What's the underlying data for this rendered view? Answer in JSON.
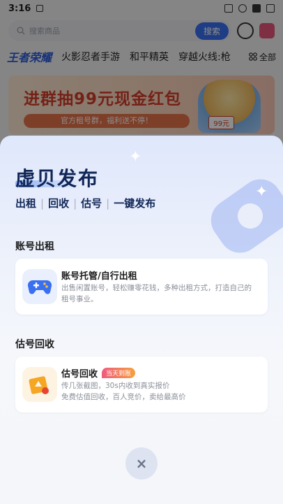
{
  "status_bar": {
    "time": "3:16"
  },
  "search": {
    "placeholder": "搜索商品",
    "button": "搜索"
  },
  "games": {
    "active": "王者荣耀",
    "items": [
      "火影忍者手游",
      "和平精英",
      "穿越火线:枪"
    ],
    "all": "全部"
  },
  "banner": {
    "headline": "进群抽99元现金红包",
    "subline": "官方租号群，福利送不停！",
    "tag": "99元"
  },
  "sheet": {
    "title": "虚贝发布",
    "features": [
      "出租",
      "回收",
      "估号",
      "一键发布"
    ],
    "rent_section": {
      "title": "账号出租",
      "card_title": "账号托管/自行出租",
      "card_desc": "出售闲置账号，轻松赚零花钱，多种出租方式，打造自己的租号事业。"
    },
    "recycle_section": {
      "title": "估号回收",
      "card_title": "估号回收",
      "badge": "当天到账",
      "card_desc_1": "传几张截图，30s内收到真实报价",
      "card_desc_2": "免费估值回收，百人竞价，卖给最高价"
    },
    "close_icon": "×"
  },
  "colors": {
    "accent": "#3a6ff0",
    "title": "#102657",
    "badge_start": "#f05a7e",
    "badge_end": "#f6a03d"
  }
}
